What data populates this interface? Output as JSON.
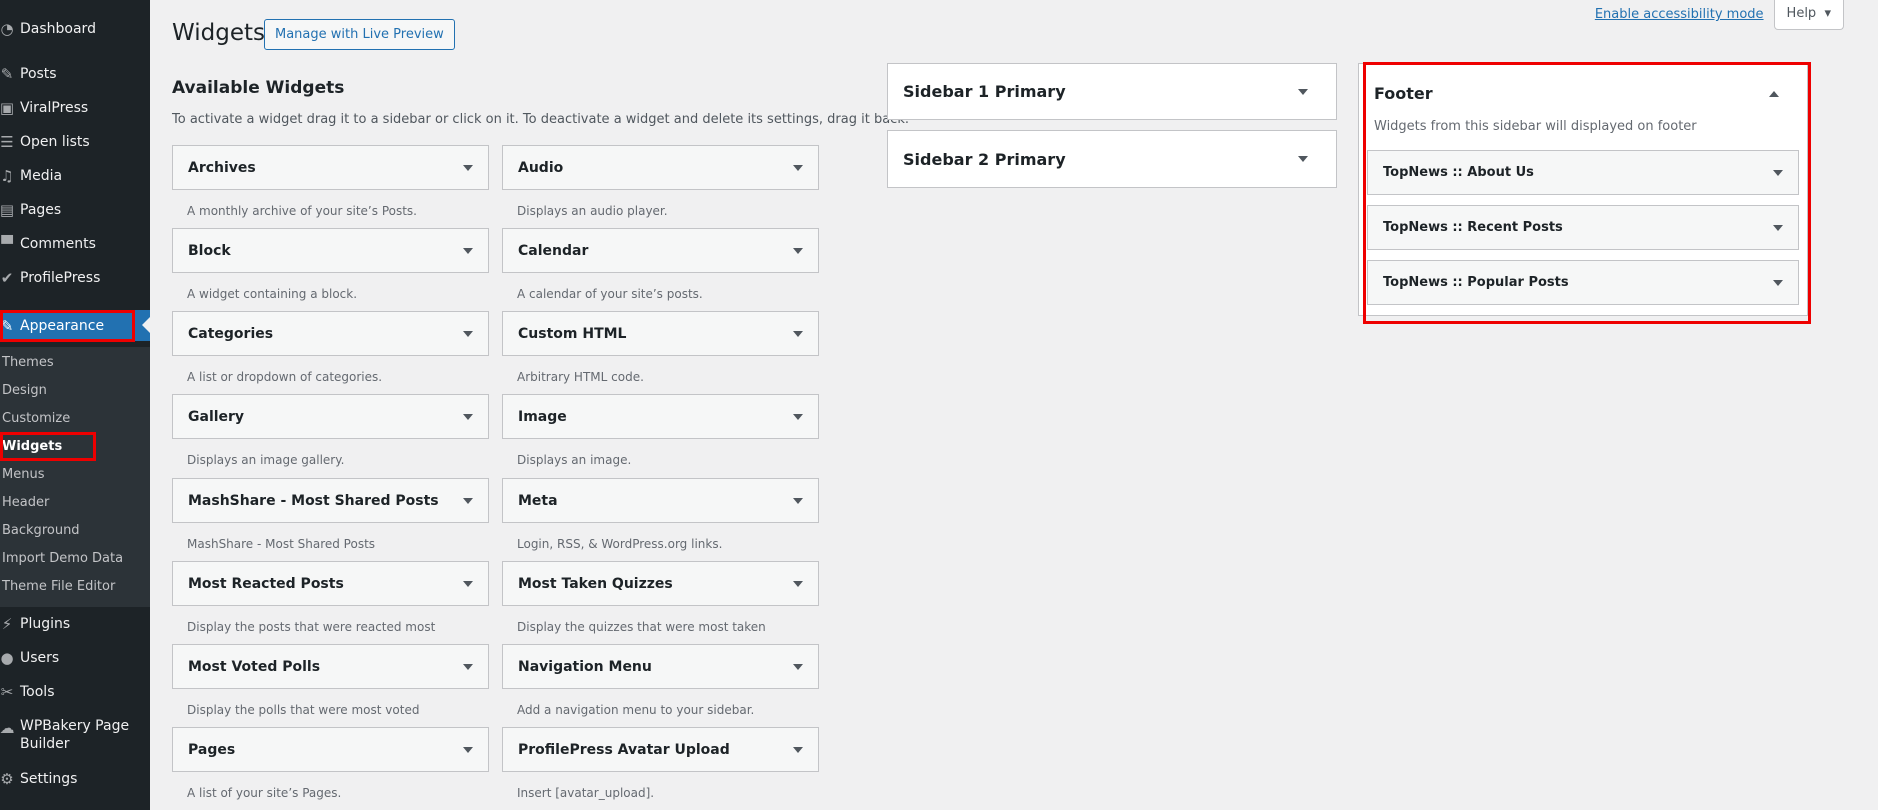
{
  "menu": {
    "items": [
      {
        "label": "Dashboard",
        "icon": "dashboard-icon"
      },
      {
        "label": "Posts",
        "icon": "pin-icon"
      },
      {
        "label": "ViralPress",
        "icon": "frame-icon"
      },
      {
        "label": "Open lists",
        "icon": "list-icon"
      },
      {
        "label": "Media",
        "icon": "media-icon"
      },
      {
        "label": "Pages",
        "icon": "pages-icon"
      },
      {
        "label": "Comments",
        "icon": "comment-icon"
      },
      {
        "label": "ProfilePress",
        "icon": "profile-icon"
      },
      {
        "label": "Appearance",
        "icon": "brush-icon"
      },
      {
        "label": "Plugins",
        "icon": "plug-icon"
      },
      {
        "label": "Users",
        "icon": "user-icon"
      },
      {
        "label": "Tools",
        "icon": "wrench-icon"
      },
      {
        "label": "WPBakery Page",
        "label2": "Builder",
        "icon": "cloud-icon"
      },
      {
        "label": "Settings",
        "icon": "settings-icon"
      }
    ],
    "submenu": [
      "Themes",
      "Design",
      "Customize",
      "Widgets",
      "Menus",
      "Header",
      "Background",
      "Import Demo Data",
      "Theme File Editor"
    ]
  },
  "top": {
    "accessibility": "Enable accessibility mode",
    "help": "Help"
  },
  "header": {
    "title": "Widgets",
    "live_preview": "Manage with Live Preview"
  },
  "available": {
    "title": "Available Widgets",
    "description": "To activate a widget drag it to a sidebar or click on it. To deactivate a widget and delete its settings, drag it back.",
    "widgets": [
      {
        "title": "Archives",
        "desc": "A monthly archive of your site’s Posts."
      },
      {
        "title": "Audio",
        "desc": "Displays an audio player."
      },
      {
        "title": "Block",
        "desc": "A widget containing a block."
      },
      {
        "title": "Calendar",
        "desc": "A calendar of your site’s posts."
      },
      {
        "title": "Categories",
        "desc": "A list or dropdown of categories."
      },
      {
        "title": "Custom HTML",
        "desc": "Arbitrary HTML code."
      },
      {
        "title": "Gallery",
        "desc": "Displays an image gallery."
      },
      {
        "title": "Image",
        "desc": "Displays an image."
      },
      {
        "title": "MashShare - Most Shared Posts",
        "desc": "MashShare - Most Shared Posts"
      },
      {
        "title": "Meta",
        "desc": "Login, RSS, & WordPress.org links."
      },
      {
        "title": "Most Reacted Posts",
        "desc": "Display the posts that were reacted most"
      },
      {
        "title": "Most Taken Quizzes",
        "desc": "Display the quizzes that were most taken"
      },
      {
        "title": "Most Voted Polls",
        "desc": "Display the polls that were most voted"
      },
      {
        "title": "Navigation Menu",
        "desc": "Add a navigation menu to your sidebar."
      },
      {
        "title": "Pages",
        "desc": "A list of your site’s Pages."
      },
      {
        "title": "ProfilePress Avatar Upload",
        "desc": "Insert [avatar_upload]."
      }
    ]
  },
  "sidebars": {
    "sidebar1": "Sidebar 1 Primary",
    "sidebar2": "Sidebar 2 Primary",
    "footer": {
      "title": "Footer",
      "description": "Widgets from this sidebar will displayed on footer",
      "widgets": [
        "TopNews :: About Us",
        "TopNews :: Recent Posts",
        "TopNews :: Popular Posts"
      ]
    }
  }
}
